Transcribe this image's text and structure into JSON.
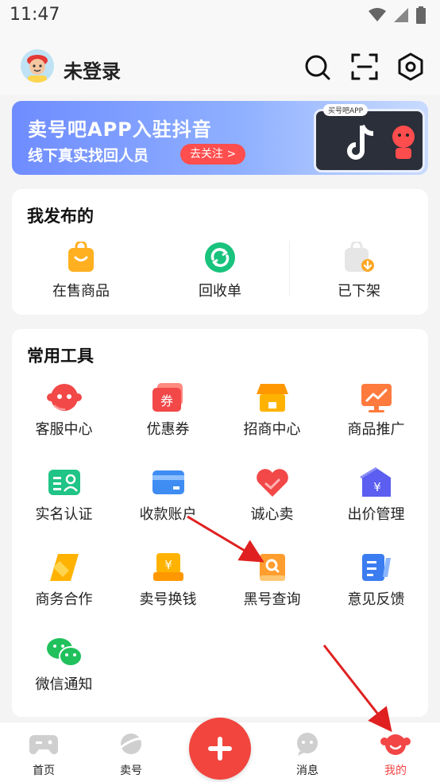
{
  "status_bar": {
    "time": "11:47"
  },
  "header": {
    "username": "未登录"
  },
  "banner": {
    "title": "卖号吧APP入驻抖音",
    "subtitle": "线下真实找回人员",
    "button": "去关注 >",
    "tag": "买号吧APP"
  },
  "published": {
    "title": "我发布的",
    "items": [
      {
        "label": "在售商品",
        "icon": "shopping-bag-icon"
      },
      {
        "label": "回收单",
        "icon": "recycle-icon"
      },
      {
        "label": "已下架",
        "icon": "bag-down-icon"
      }
    ]
  },
  "tools": {
    "title": "常用工具",
    "items": [
      {
        "label": "客服中心",
        "icon": "customer-service-icon"
      },
      {
        "label": "优惠券",
        "icon": "coupon-icon"
      },
      {
        "label": "招商中心",
        "icon": "store-icon"
      },
      {
        "label": "商品推广",
        "icon": "promotion-icon"
      },
      {
        "label": "实名认证",
        "icon": "id-card-icon"
      },
      {
        "label": "收款账户",
        "icon": "bank-card-icon"
      },
      {
        "label": "诚心卖",
        "icon": "heart-icon"
      },
      {
        "label": "出价管理",
        "icon": "bid-icon"
      },
      {
        "label": "商务合作",
        "icon": "cooperation-icon"
      },
      {
        "label": "卖号换钱",
        "icon": "exchange-icon"
      },
      {
        "label": "黑号查询",
        "icon": "blacklist-search-icon"
      },
      {
        "label": "意见反馈",
        "icon": "feedback-icon"
      },
      {
        "label": "微信通知",
        "icon": "wechat-icon"
      }
    ]
  },
  "tabbar": {
    "tabs": [
      {
        "label": "首页",
        "icon": "gamepad-icon"
      },
      {
        "label": "卖号",
        "icon": "planet-icon"
      },
      {
        "label": "消息",
        "icon": "chat-icon"
      },
      {
        "label": "我的",
        "icon": "mascot-icon"
      }
    ],
    "active_color": "#f24646"
  },
  "colors": {
    "accent": "#f1453d",
    "annotation_arrow": "#e02020"
  }
}
